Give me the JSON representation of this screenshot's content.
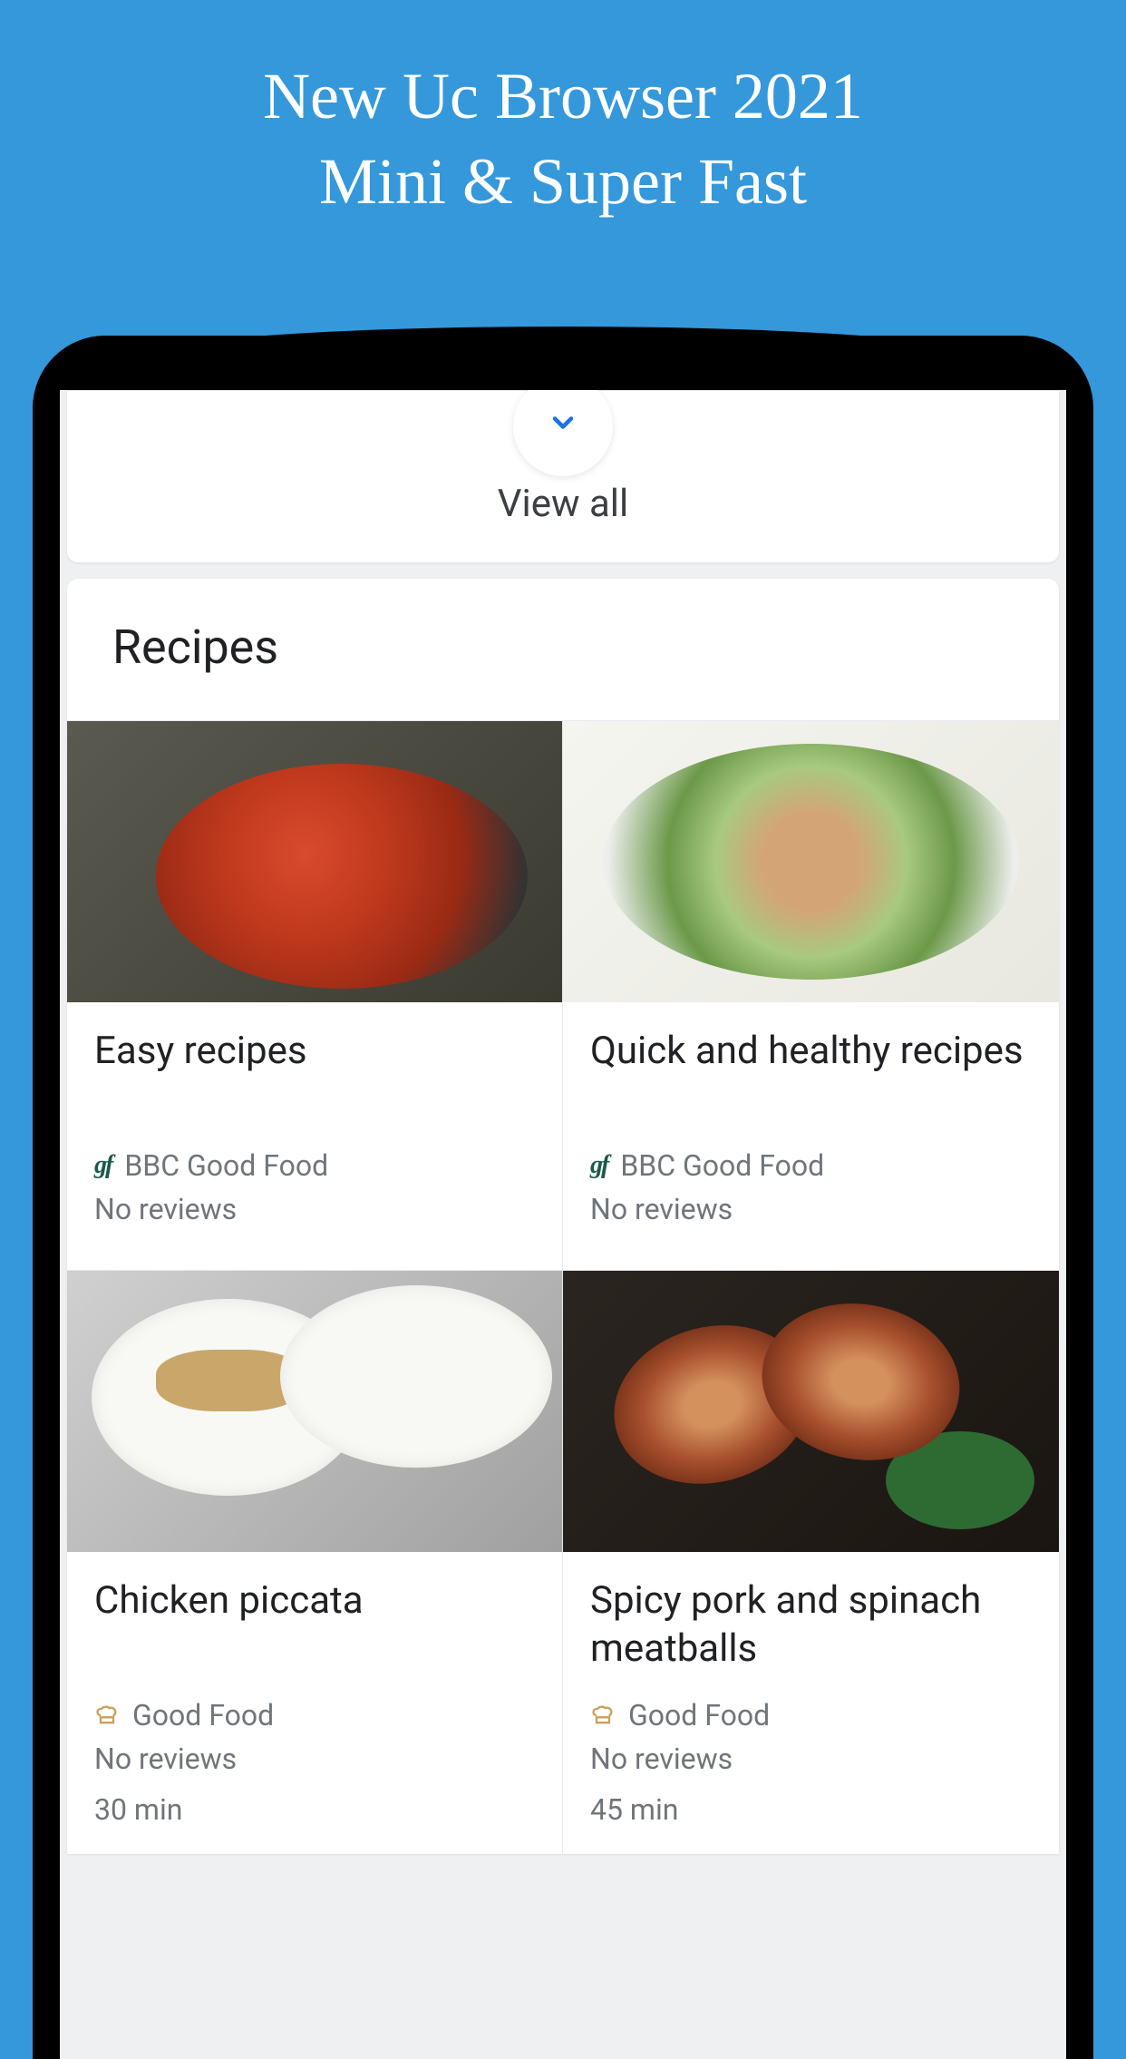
{
  "promo": {
    "line1": "New Uc Browser 2021",
    "line2": "Mini & Super Fast"
  },
  "viewAll": {
    "label": "View all"
  },
  "recipesSection": {
    "title": "Recipes"
  },
  "recipes": [
    {
      "title": "Easy recipes",
      "sourceIcon": "gf",
      "source": "BBC Good Food",
      "reviews": "No reviews",
      "time": ""
    },
    {
      "title": "Quick and healthy recipes",
      "sourceIcon": "gf",
      "source": "BBC Good Food",
      "reviews": "No reviews",
      "time": ""
    },
    {
      "title": "Chicken piccata",
      "sourceIcon": "chef",
      "source": "Good Food",
      "reviews": "No reviews",
      "time": "30 min"
    },
    {
      "title": "Spicy pork and spinach meatballs",
      "sourceIcon": "chef",
      "source": "Good Food",
      "reviews": "No reviews",
      "time": "45 min"
    }
  ]
}
